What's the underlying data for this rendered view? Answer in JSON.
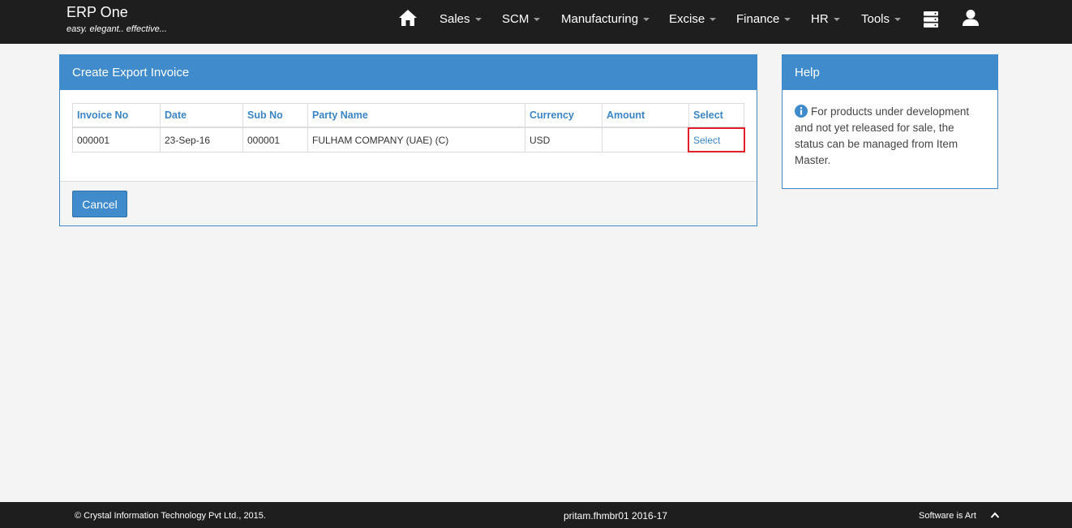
{
  "navbar": {
    "brand_name": "ERP One",
    "brand_tagline": "easy. elegant.. effective...",
    "menu": [
      "Sales",
      "SCM",
      "Manufacturing",
      "Excise",
      "Finance",
      "HR",
      "Tools"
    ],
    "icons": {
      "home": "home-icon",
      "database": "database-icon",
      "user": "user-icon"
    }
  },
  "panel": {
    "title": "Create Export Invoice",
    "columns": [
      "Invoice No",
      "Date",
      "Sub No",
      "Party Name",
      "Currency",
      "Amount",
      "Select"
    ],
    "rows": [
      {
        "invoice_no": "000001",
        "date": "23-Sep-16",
        "sub_no": "000001",
        "party_name": "FULHAM COMPANY (UAE) (C)",
        "currency": "USD",
        "amount": "",
        "select": "Select"
      }
    ],
    "cancel_label": "Cancel"
  },
  "help": {
    "title": "Help",
    "text": "For products under development and not yet released for sale, the status can be managed from Item Master."
  },
  "footer": {
    "copyright": "© Crystal Information Technology Pvt Ltd., 2015.",
    "session": "pritam.fhmbr01 2016-17",
    "slogan": "Software is Art"
  },
  "colors": {
    "navbar": "#1e1e1e",
    "accent": "#3f8bcb",
    "highlight": "#e2202a",
    "background": "#f4f4f4"
  }
}
